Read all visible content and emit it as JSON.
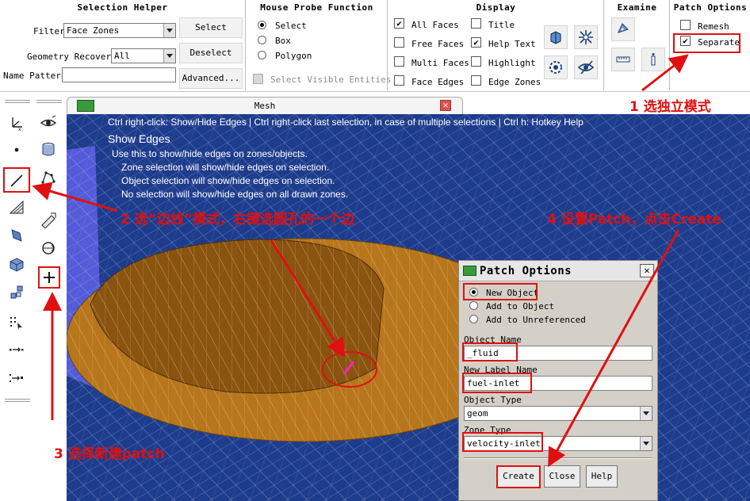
{
  "selection_helper": {
    "title": "Selection Helper",
    "filter_label": "Filter",
    "filter_value": "Face Zones",
    "geometry_recovery_label": "Geometry Recovery",
    "geometry_recovery_value": "All",
    "name_pattern_label": "Name Pattern",
    "name_pattern_value": "",
    "select_label": "Select",
    "deselect_label": "Deselect",
    "advanced_label": "Advanced..."
  },
  "mouse_probe": {
    "title": "Mouse Probe Function",
    "options": [
      "Select",
      "Box",
      "Polygon"
    ],
    "selected": "Select",
    "visible_entities_label": "Select Visible Entities"
  },
  "display": {
    "title": "Display",
    "checks": [
      {
        "label": "All Faces",
        "checked": true
      },
      {
        "label": "Free Faces",
        "checked": false
      },
      {
        "label": "Multi Faces",
        "checked": false
      },
      {
        "label": "Face Edges",
        "checked": false
      },
      {
        "label": "Title",
        "checked": false
      },
      {
        "label": "Help Text",
        "checked": true
      },
      {
        "label": "Highlight",
        "checked": false
      },
      {
        "label": "Edge Zones",
        "checked": false
      }
    ]
  },
  "examine": {
    "title": "Examine"
  },
  "patch_options_panel": {
    "title": "Patch Options",
    "remesh_label": "Remesh",
    "remesh_checked": false,
    "separate_label": "Separate",
    "separate_checked": true
  },
  "mesh_window": {
    "title": "Mesh",
    "hint_line": "Ctrl right-click: Show/Hide Edges | Ctrl right-click last selection, in case of multiple selections | Ctrl h: Hotkey Help",
    "mode_title": "Show Edges",
    "help_lines": [
      "Use this to show/hide edges on zones/objects.",
      "Zone selection will show/hide edges on selection.",
      "Object selection will show/hide edges on selection.",
      "No selection will show/hide edges on all drawn zones."
    ]
  },
  "patch_dialog": {
    "title": "Patch Options",
    "radio_options": [
      "New Object",
      "Add to Object",
      "Add to Unreferenced"
    ],
    "radio_selected": "New Object",
    "object_name_label": "Object Name",
    "object_name_value": "_fluid",
    "new_label_name_label": "New Label Name",
    "new_label_name_value": "fuel-inlet",
    "object_type_label": "Object Type",
    "object_type_value": "geom",
    "zone_type_label": "Zone Type",
    "zone_type_value": "velocity-inlet",
    "create_label": "Create",
    "close_label": "Close",
    "help_label": "Help"
  },
  "annotations": {
    "step1": "1 选独立模式",
    "step2": "2 选“边线”模式，右键选圆孔的一个边",
    "step3": "3 选择新建patch",
    "step4": "4 设置Patch，点击Create"
  },
  "colors": {
    "viewport_bg": "#1e3c8c",
    "surface": "#b8761c",
    "annotation": "#e01010"
  }
}
